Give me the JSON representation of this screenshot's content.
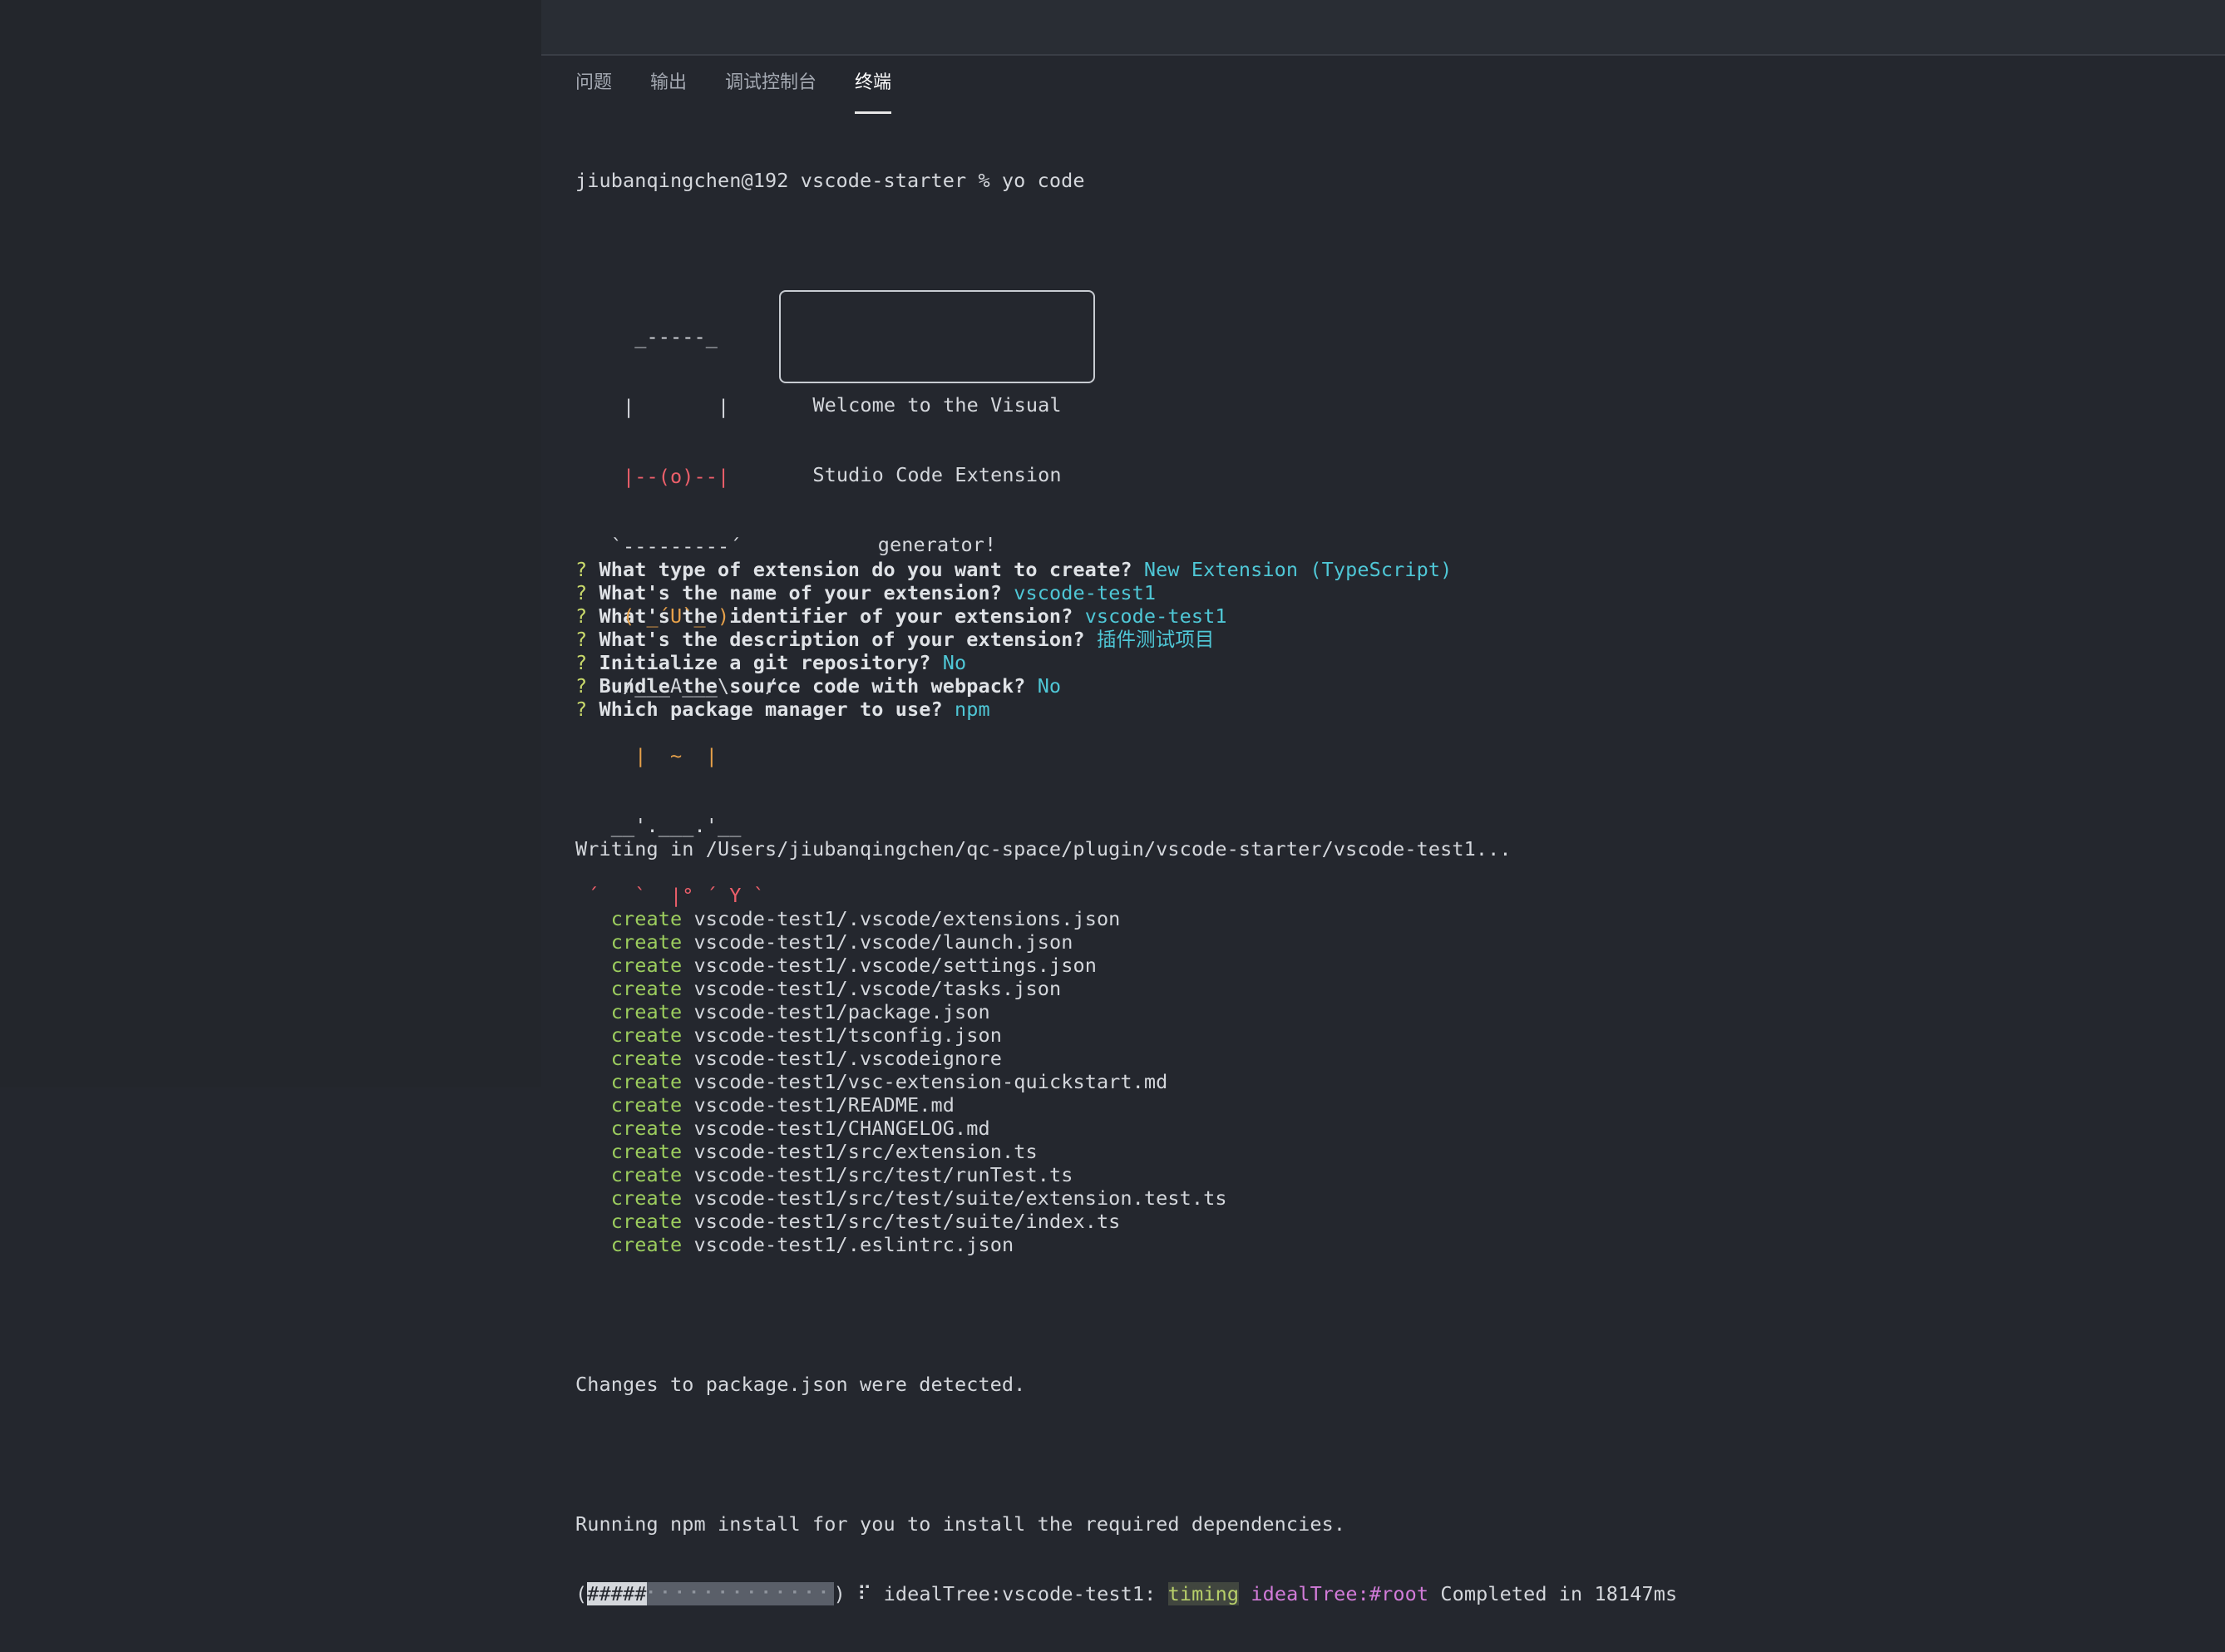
{
  "tabs": [
    {
      "label": "问题",
      "active": false
    },
    {
      "label": "输出",
      "active": false
    },
    {
      "label": "调试控制台",
      "active": false
    },
    {
      "label": "终端",
      "active": true
    }
  ],
  "terminal": {
    "prompt": "jiubanqingchen@192 vscode-starter % yo code",
    "art": [
      "     _-----_     ",
      "    |       |    ",
      "    |--(o)--|    ",
      "   `---------´   ",
      "    ( _´U`_ )    ",
      "    /___A___\\   /",
      "     |  ~  |     ",
      "   __'.___.'__   ",
      " ´   `  |° ´ Y ` "
    ],
    "welcome": [
      "Welcome to the Visual",
      "Studio Code Extension",
      "generator!"
    ],
    "questions": [
      {
        "mark": "?",
        "q": "What type of extension do you want to create?",
        "a": "New Extension (TypeScript)"
      },
      {
        "mark": "?",
        "q": "What's the name of your extension?",
        "a": "vscode-test1"
      },
      {
        "mark": "?",
        "q": "What's the identifier of your extension?",
        "a": "vscode-test1"
      },
      {
        "mark": "?",
        "q": "What's the description of your extension?",
        "a": "插件测试项目"
      },
      {
        "mark": "?",
        "q": "Initialize a git repository?",
        "a": "No"
      },
      {
        "mark": "?",
        "q": "Bundle the source code with webpack?",
        "a": "No"
      },
      {
        "mark": "?",
        "q": "Which package manager to use?",
        "a": "npm"
      }
    ],
    "writing": "Writing in /Users/jiubanqingchen/qc-space/plugin/vscode-starter/vscode-test1...",
    "create_word": "create",
    "files": [
      "vscode-test1/.vscode/extensions.json",
      "vscode-test1/.vscode/launch.json",
      "vscode-test1/.vscode/settings.json",
      "vscode-test1/.vscode/tasks.json",
      "vscode-test1/package.json",
      "vscode-test1/tsconfig.json",
      "vscode-test1/.vscodeignore",
      "vscode-test1/vsc-extension-quickstart.md",
      "vscode-test1/README.md",
      "vscode-test1/CHANGELOG.md",
      "vscode-test1/src/extension.ts",
      "vscode-test1/src/test/runTest.ts",
      "vscode-test1/src/test/suite/extension.test.ts",
      "vscode-test1/src/test/suite/index.ts",
      "vscode-test1/.eslintrc.json"
    ],
    "changes": "Changes to package.json were detected.",
    "running": "Running npm install for you to install the required dependencies.",
    "progress": {
      "open": "(",
      "done": "#####",
      "todo": "⠂⠂⠂⠂⠂⠂⠂⠂⠂⠂⠂⠂⠂",
      "close": ")",
      "spinner": "⠏",
      "stage": "idealTree:vscode-test1:",
      "timing": "timing",
      "tree": "idealTree:#root",
      "status": "Completed in 18147ms"
    }
  }
}
